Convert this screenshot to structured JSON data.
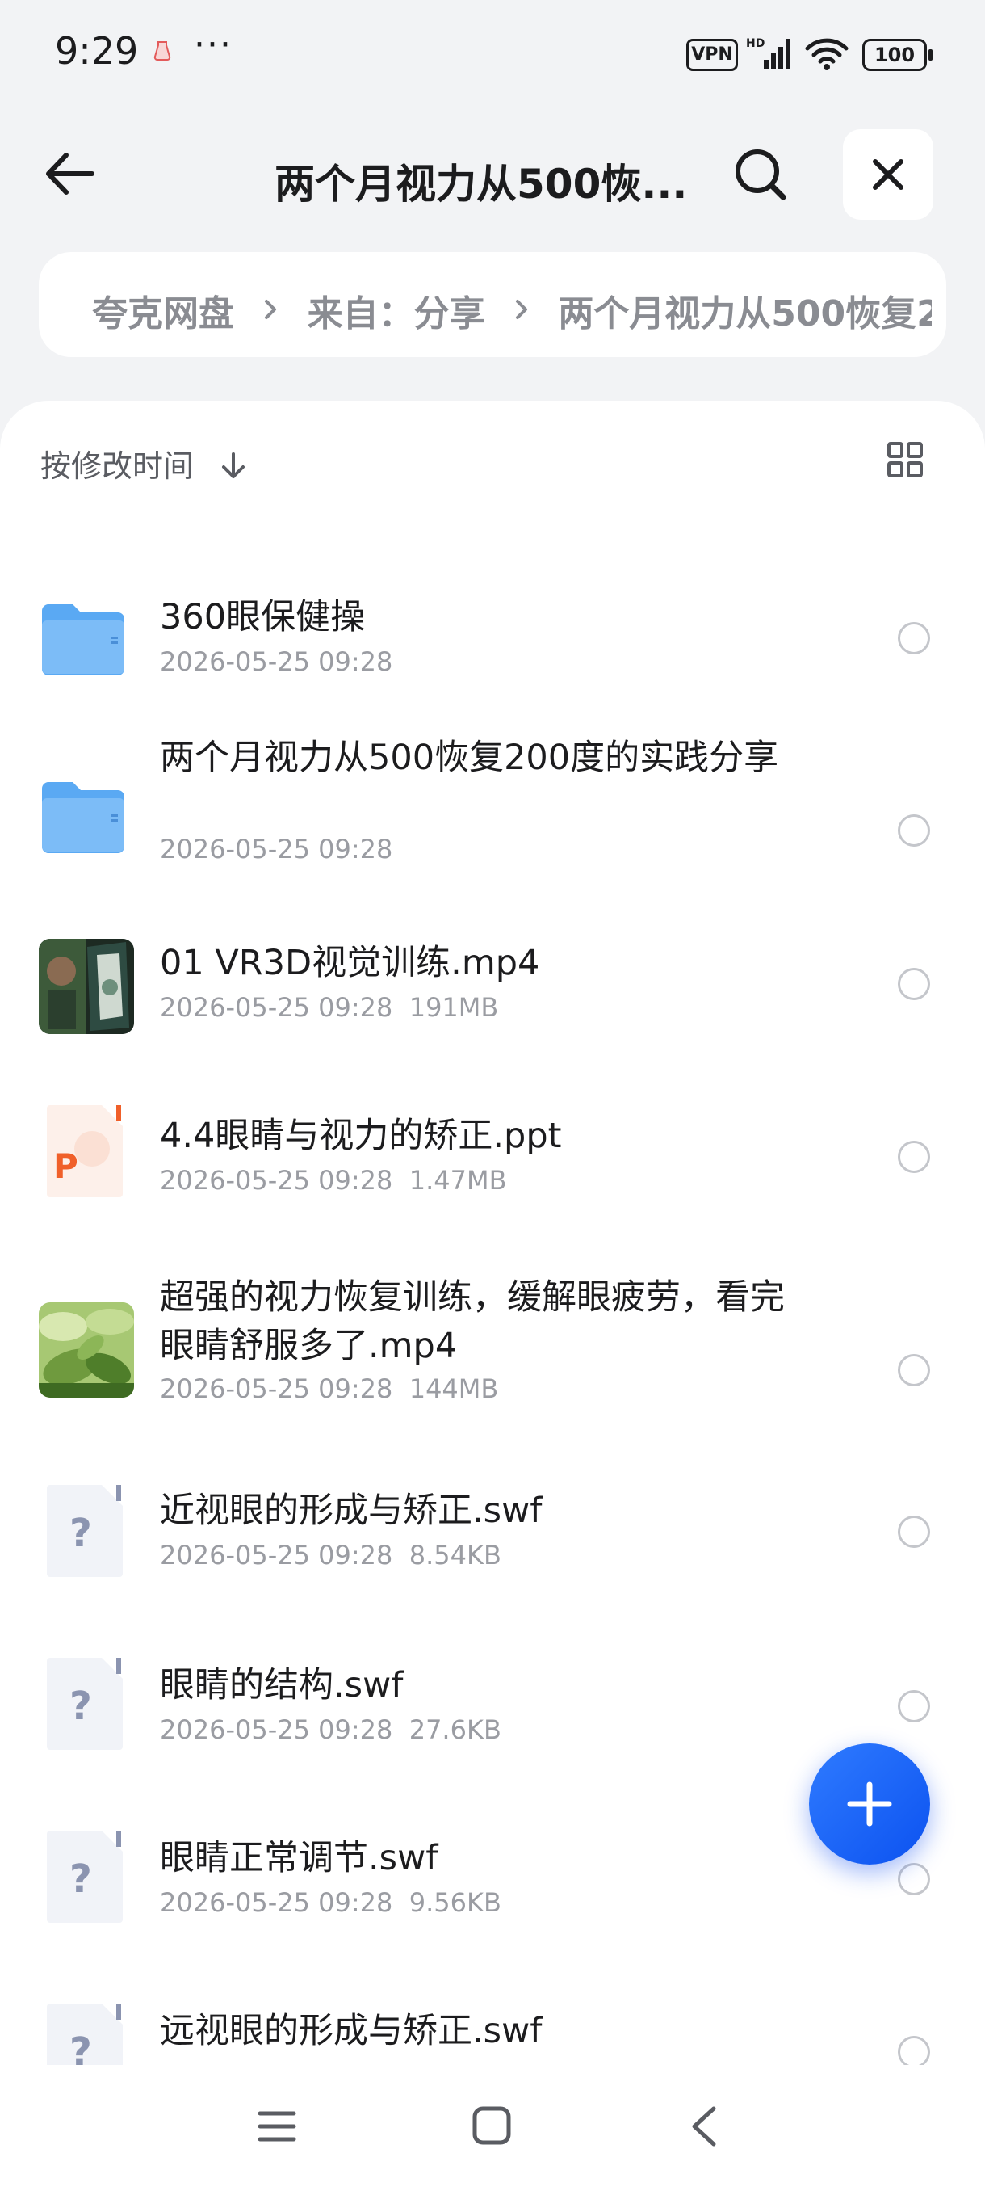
{
  "status_bar": {
    "time": "9:29",
    "more": "···",
    "vpn": "VPN",
    "signal_label": "HD",
    "battery": "100"
  },
  "header": {
    "title": "两个月视力从500恢..."
  },
  "breadcrumb": {
    "items": [
      "夸克网盘",
      "来自：分享",
      "两个月视力从500恢复2"
    ]
  },
  "toolbar": {
    "sort_label": "按修改时间"
  },
  "files": [
    {
      "name": "360眼保健操",
      "meta": "2026-05-25 09:28",
      "type": "folder"
    },
    {
      "name": "两个月视力从500恢复200度的实践分享",
      "meta": "2026-05-25 09:28",
      "type": "folder"
    },
    {
      "name": "01 VR3D视觉训练.mp4",
      "meta": "2026-05-25 09:28  191MB",
      "type": "video"
    },
    {
      "name": "4.4眼睛与视力的矫正.ppt",
      "meta": "2026-05-25 09:28  1.47MB",
      "type": "ppt"
    },
    {
      "name": "超强的视力恢复训练，缓解眼疲劳，看完眼睛舒服多了.mp4",
      "meta": "2026-05-25 09:28  144MB",
      "type": "video"
    },
    {
      "name": "近视眼的形成与矫正.swf",
      "meta": "2026-05-25 09:28  8.54KB",
      "type": "unknown"
    },
    {
      "name": "眼睛的结构.swf",
      "meta": "2026-05-25 09:28  27.6KB",
      "type": "unknown"
    },
    {
      "name": "眼睛正常调节.swf",
      "meta": "2026-05-25 09:28  9.56KB",
      "type": "unknown"
    },
    {
      "name": "远视眼的形成与矫正.swf",
      "meta": "",
      "type": "unknown"
    }
  ],
  "icons": {
    "ppt_letter": "P",
    "unknown_letter": "?"
  },
  "colors": {
    "accent": "#1a5ff5",
    "folder": "#5aa9f3",
    "ppt": "#f0602a"
  }
}
